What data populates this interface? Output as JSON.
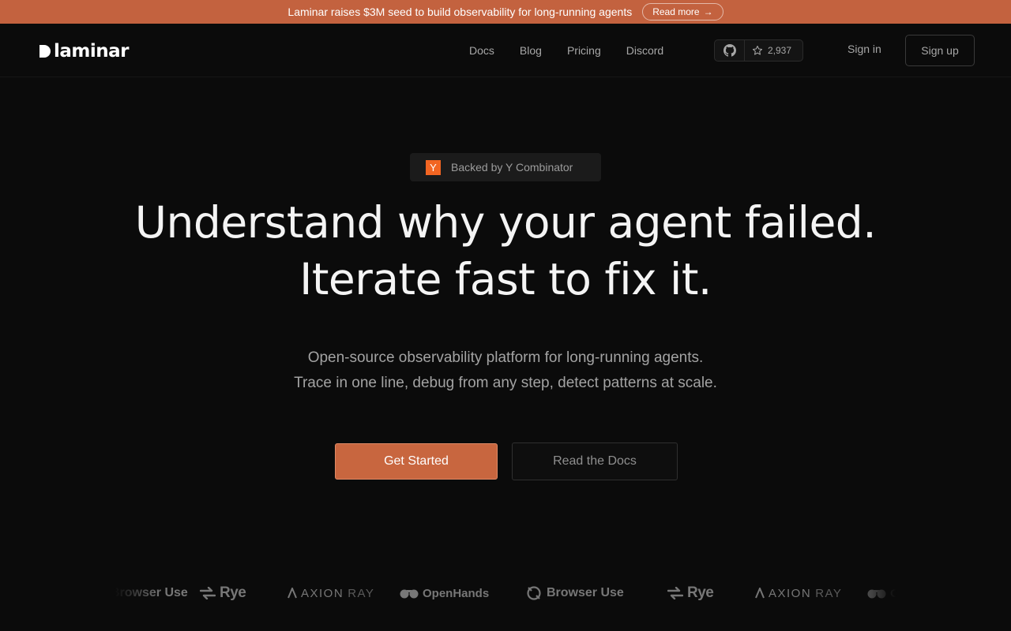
{
  "banner": {
    "text": "Laminar raises $3M seed to build observability for long-running agents",
    "link_label": "Read more",
    "link_arrow": "→"
  },
  "nav": {
    "brand": "laminar",
    "links": [
      {
        "label": "Docs"
      },
      {
        "label": "Blog"
      },
      {
        "label": "Pricing"
      },
      {
        "label": "Discord"
      }
    ],
    "github": {
      "icon": "github-icon",
      "star_icon": "star-icon",
      "stars": "2,937"
    },
    "sign_in": "Sign in",
    "sign_up": "Sign up"
  },
  "hero": {
    "badge_logo": "Y",
    "badge_text": "Backed by Y Combinator",
    "headline_line1": "Understand why your agent failed.",
    "headline_line2": "Iterate fast to fix it.",
    "sub_line1": "Open-source observability platform for long-running agents.",
    "sub_line2": "Trace in one line, debug from any step, detect patterns at scale.",
    "cta_primary": "Get Started",
    "cta_secondary": "Read the Docs"
  },
  "logos": {
    "items": [
      {
        "name": "Browser Use",
        "icon": "browser-use-icon"
      },
      {
        "name": "Rye",
        "icon": "rye-icon"
      },
      {
        "name": "AXION",
        "suffix": "RAY",
        "icon": "axion-icon"
      },
      {
        "name": "OpenHands",
        "icon": "openhands-icon"
      },
      {
        "name": "Browser Use",
        "icon": "browser-use-icon"
      },
      {
        "name": "Rye",
        "icon": "rye-icon"
      },
      {
        "name": "AXION",
        "suffix": "RAY",
        "icon": "axion-icon"
      },
      {
        "name": "OpenHands",
        "icon": "openhands-icon"
      }
    ]
  },
  "colors": {
    "accent": "#c8663f",
    "banner": "#c3623f",
    "background": "#0b0b0b",
    "yc_orange": "#f26522"
  }
}
